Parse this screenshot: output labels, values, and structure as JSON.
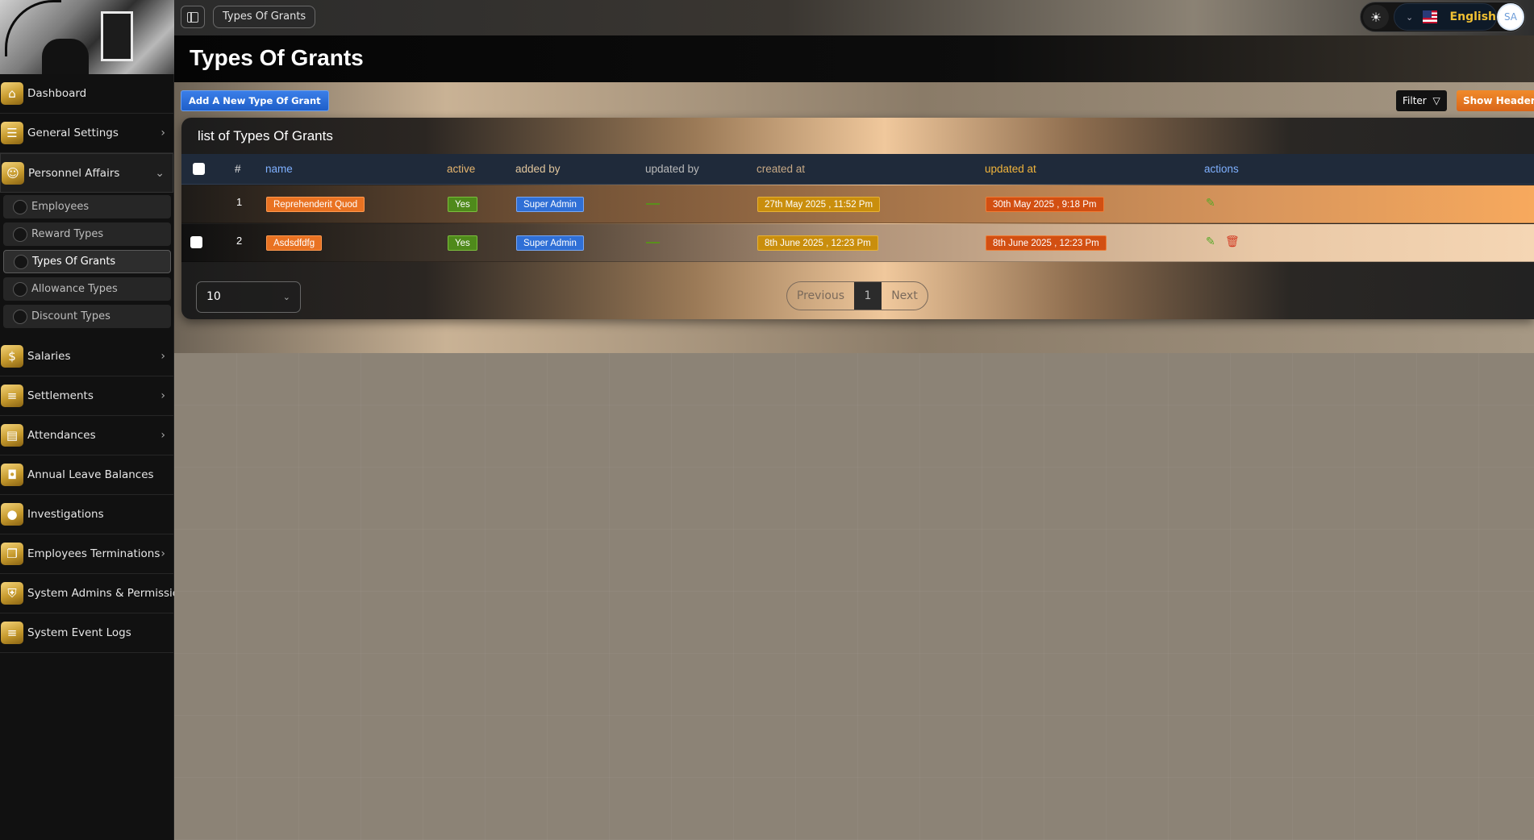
{
  "sidebar": {
    "items": [
      {
        "label": "Dashboard",
        "icon": "home-icon"
      },
      {
        "label": "General Settings",
        "icon": "sliders-icon"
      },
      {
        "label": "Personnel Affairs",
        "icon": "users-icon"
      },
      {
        "label": "Salaries",
        "icon": "money-icon"
      },
      {
        "label": "Settlements",
        "icon": "list-icon"
      },
      {
        "label": "Attendances",
        "icon": "briefcase-icon"
      },
      {
        "label": "Annual Leave Balances",
        "icon": "bag-icon"
      },
      {
        "label": "Investigations",
        "icon": "circle-icon"
      },
      {
        "label": "Employees Terminations",
        "icon": "copy-icon"
      },
      {
        "label": "System Admins & Permissions",
        "icon": "shield-icon"
      },
      {
        "label": "System Event Logs",
        "icon": "log-icon"
      }
    ],
    "submenu": [
      {
        "label": "Employees"
      },
      {
        "label": "Reward Types"
      },
      {
        "label": "Types Of Grants"
      },
      {
        "label": "Allowance Types"
      },
      {
        "label": "Discount Types"
      }
    ]
  },
  "topbar": {
    "breadcrumb": "Types Of Grants",
    "language": "English",
    "avatar_initials": "SA"
  },
  "page": {
    "title": "Types Of Grants",
    "add_button": "Add A New Type Of Grant",
    "filter_button": "Filter",
    "show_headers_button": "Show Headers"
  },
  "table": {
    "title": "list of Types Of Grants",
    "headers": {
      "num": "#",
      "name": "name",
      "active": "active",
      "added_by": "added by",
      "updated_by": "updated by",
      "created_at": "created at",
      "updated_at": "updated at",
      "actions": "actions"
    },
    "rows": [
      {
        "num": "1",
        "name": "Reprehenderit Quod",
        "active": "Yes",
        "added_by": "Super Admin",
        "created_at": "27th May 2025 , 11:52 Pm",
        "updated_at": "30th May 2025 , 9:18 Pm"
      },
      {
        "num": "2",
        "name": "Asdsdfdfg",
        "active": "Yes",
        "added_by": "Super Admin",
        "created_at": "8th June 2025 , 12:23 Pm",
        "updated_at": "8th June 2025 , 12:23 Pm"
      }
    ]
  },
  "pagination": {
    "per_page": "10",
    "previous": "Previous",
    "current": "1",
    "next": "Next"
  },
  "colors": {
    "sidebar_bg": "#111111",
    "gold_accent": "#c69a2d",
    "add_button": "#2f6fd6",
    "show_headers_button": "#e97222"
  }
}
